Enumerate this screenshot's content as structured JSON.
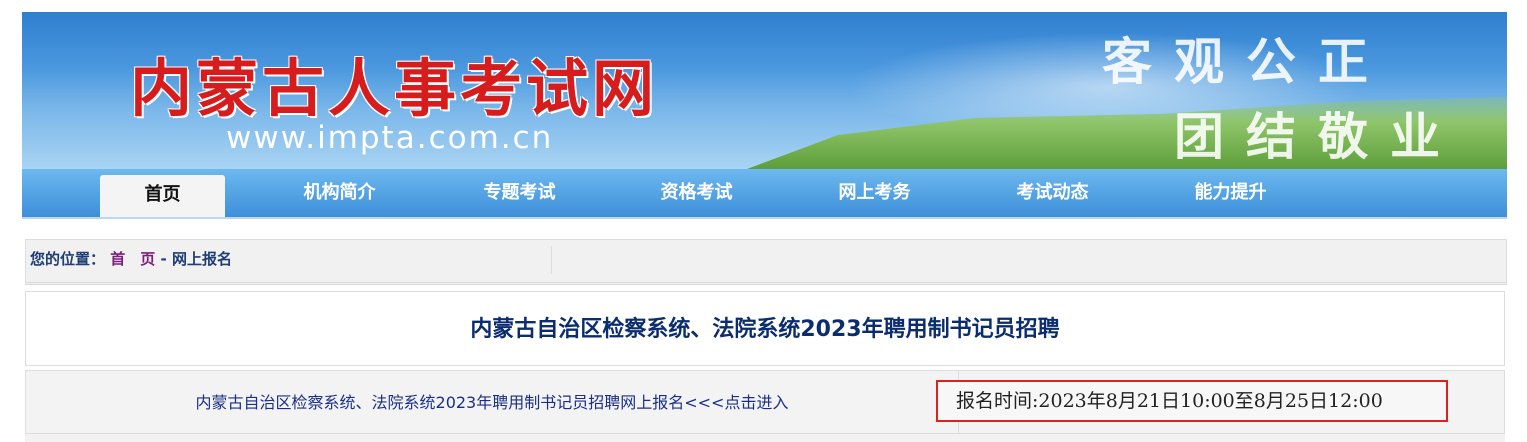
{
  "banner": {
    "site_title": "内蒙古人事考试网",
    "site_url": "www.impta.com.cn",
    "slogan_line1": "客观公正",
    "slogan_line2": "团结敬业"
  },
  "nav": {
    "items": [
      {
        "label": "首页",
        "active": true
      },
      {
        "label": "机构简介"
      },
      {
        "label": "专题考试"
      },
      {
        "label": "资格考试"
      },
      {
        "label": "网上考务"
      },
      {
        "label": "考试动态"
      },
      {
        "label": "能力提升"
      }
    ]
  },
  "breadcrumb": {
    "prefix": "您的位置：",
    "home": "首　页",
    "separator": " - ",
    "current": "网上报名"
  },
  "main": {
    "title": "内蒙古自治区检察系统、法院系统2023年聘用制书记员招聘",
    "register_link": "内蒙古自治区检察系统、法院系统2023年聘用制书记员招聘网上报名<<<点击进入",
    "register_time": "报名时间:2023年8月21日10:00至8月25日12:00"
  },
  "colors": {
    "title_red": "#d61c1c",
    "nav_blue": "#3d8fd9",
    "link_blue": "#1a2f8a",
    "highlight_border": "#e02020"
  }
}
